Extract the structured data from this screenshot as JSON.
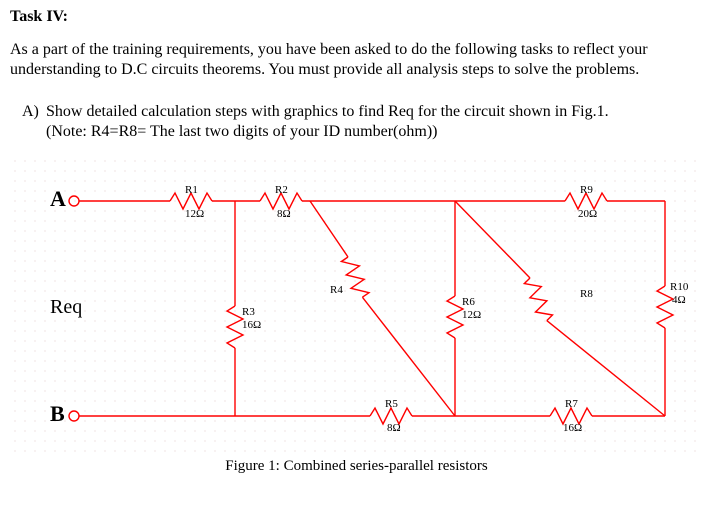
{
  "title": "Task IV:",
  "intro": "As a part of the training requirements, you have been asked to do the following tasks to reflect your understanding to D.C circuits theorems. You must provide all analysis steps to solve the problems.",
  "part_letter": "A)",
  "part_text": "Show detailed calculation steps with graphics to find Req for the circuit shown in Fig.1.",
  "part_note": "(Note: R4=R8= The last two digits of your ID number(ohm))",
  "node_A": "A",
  "node_B": "B",
  "req_label": "Req",
  "caption": "Figure 1: Combined series-parallel resistors",
  "R1_name": "R1",
  "R1_val": "12Ω",
  "R2_name": "R2",
  "R2_val": "8Ω",
  "R3_name": "R3",
  "R3_val": "16Ω",
  "R4_name": "R4",
  "R5_name": "R5",
  "R5_val": "8Ω",
  "R6_name": "R6",
  "R6_val": "12Ω",
  "R7_name": "R7",
  "R7_val": "16Ω",
  "R8_name": "R8",
  "R9_name": "R9",
  "R9_val": "20Ω",
  "R10_name": "R10",
  "R10_val": "4Ω",
  "chart_data": {
    "type": "table",
    "title": "Figure 1: Combined series-parallel resistors",
    "notes": "R4 and R8 equal the last two digits of the student's ID (ohms). Req is measured between terminals A and B.",
    "resistors": [
      {
        "name": "R1",
        "ohms": 12
      },
      {
        "name": "R2",
        "ohms": 8
      },
      {
        "name": "R3",
        "ohms": 16
      },
      {
        "name": "R4",
        "ohms": null
      },
      {
        "name": "R5",
        "ohms": 8
      },
      {
        "name": "R6",
        "ohms": 12
      },
      {
        "name": "R7",
        "ohms": 16
      },
      {
        "name": "R8",
        "ohms": null
      },
      {
        "name": "R9",
        "ohms": 20
      },
      {
        "name": "R10",
        "ohms": 4
      }
    ]
  }
}
